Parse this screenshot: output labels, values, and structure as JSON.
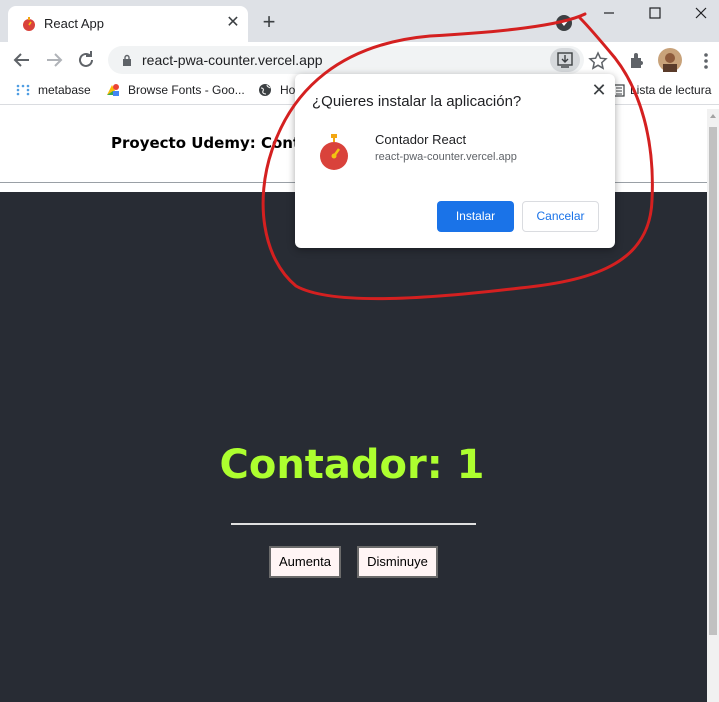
{
  "browser": {
    "tab_title": "React App",
    "url": "react-pwa-counter.vercel.app",
    "bookmarks": [
      "metabase",
      "Browse Fonts - Goo...",
      "Ho",
      "Lista de lectura"
    ]
  },
  "page": {
    "header_title": "Proyecto Udemy: Contad",
    "counter_text": "Contador: 1",
    "increase_label": "Aumenta",
    "decrease_label": "Disminuye"
  },
  "install_dialog": {
    "title": "¿Quieres instalar la aplicación?",
    "app_name": "Contador React",
    "app_url": "react-pwa-counter.vercel.app",
    "install_label": "Instalar",
    "cancel_label": "Cancelar"
  },
  "colors": {
    "app_background": "#282c34",
    "counter_text": "#adff2f",
    "install_button": "#1a73e8",
    "annotation_stroke": "#d42020"
  },
  "icons": [
    "react-favicon-icon",
    "close-icon",
    "new-tab-icon",
    "tab-search-icon",
    "minimize-icon",
    "maximize-icon",
    "window-close-icon",
    "back-icon",
    "forward-icon",
    "reload-icon",
    "lock-icon",
    "install-app-icon",
    "star-icon",
    "extensions-icon",
    "profile-avatar",
    "more-menu-icon",
    "metabase-icon",
    "fonts-icon",
    "globe-icon",
    "reading-list-icon",
    "stopwatch-app-icon"
  ]
}
